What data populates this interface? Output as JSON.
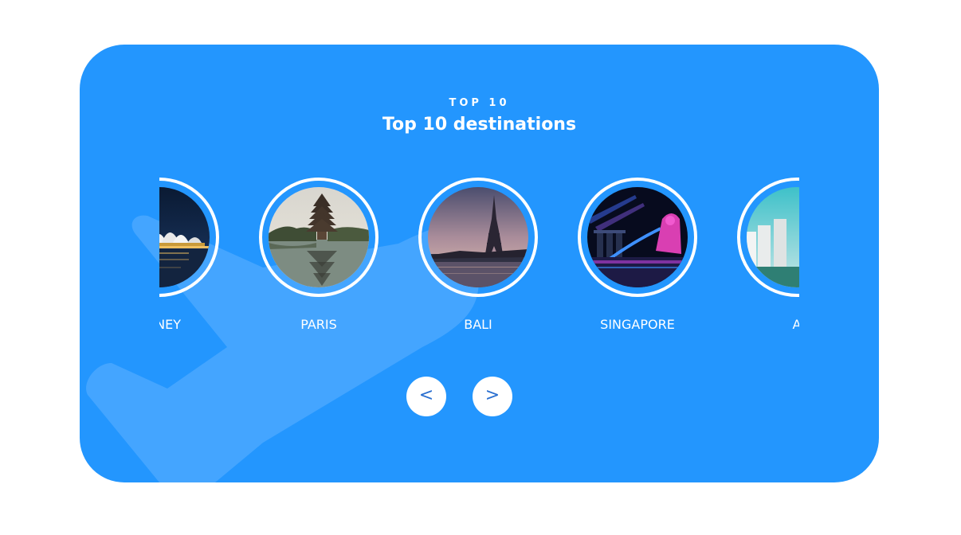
{
  "header": {
    "eyebrow": "TOP 10",
    "title": "Top 10 destinations"
  },
  "destinations": [
    {
      "label": "YDNEY",
      "image": "sydney-opera-house-photo"
    },
    {
      "label": "PARIS",
      "image": "temple-lake-photo"
    },
    {
      "label": "BALI",
      "image": "eiffel-tower-photo"
    },
    {
      "label": "SINGAPORE",
      "image": "merlion-marina-bay-photo"
    },
    {
      "label": "A",
      "image": "white-buildings-photo"
    }
  ],
  "navigation": {
    "prev_label": "<",
    "next_label": ">",
    "prev_icon": "chevron-left-icon",
    "next_icon": "chevron-right-icon"
  },
  "colors": {
    "card_background": "#2396fe",
    "watermark": "#4aa8ff",
    "text": "#ffffff",
    "button_background": "#ffffff",
    "button_text": "#2a6fd0"
  }
}
